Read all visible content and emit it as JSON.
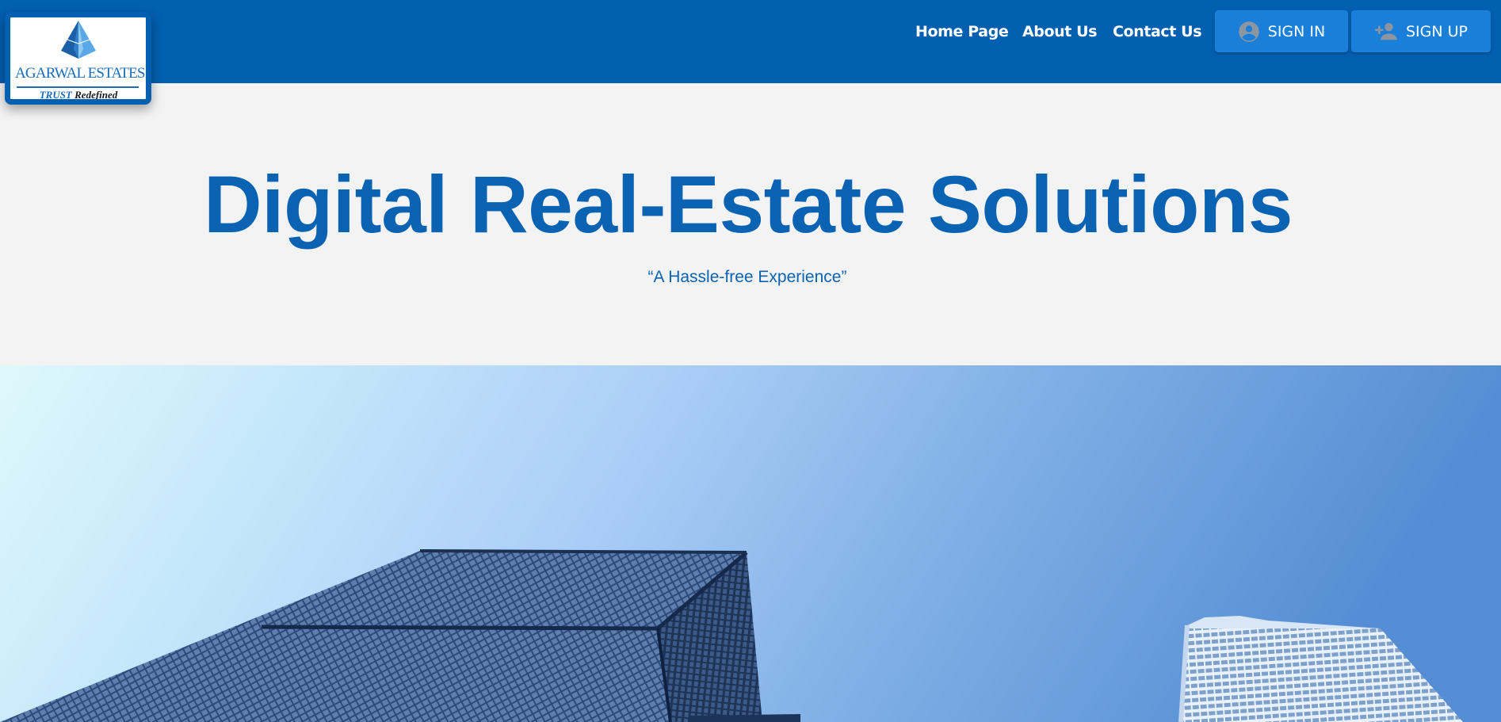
{
  "header": {
    "logo": {
      "brand": "AGARWAL ESTATES",
      "registered_mark": "®",
      "tagline_part1": "TRUST",
      "tagline_part2": "Redefined",
      "icon": "pyramid-logo-icon"
    },
    "nav": {
      "home": "Home Page",
      "about": "About Us",
      "contact": "Contact Us"
    },
    "auth": {
      "sign_in_label": "SIGN IN",
      "sign_in_icon": "account-circle-icon",
      "sign_up_label": "SIGN UP",
      "sign_up_icon": "person-add-icon"
    }
  },
  "hero": {
    "title": "Digital Real-Estate Solutions",
    "subtitle": "“A Hassle-free Experience”"
  },
  "banner": {
    "image": "skyscrapers-against-blue-sky"
  },
  "colors": {
    "nav_bar": "#035fb0",
    "button": "#1a7fd8",
    "title_text": "#0a62b3",
    "page_background": "#f3f3f3"
  }
}
